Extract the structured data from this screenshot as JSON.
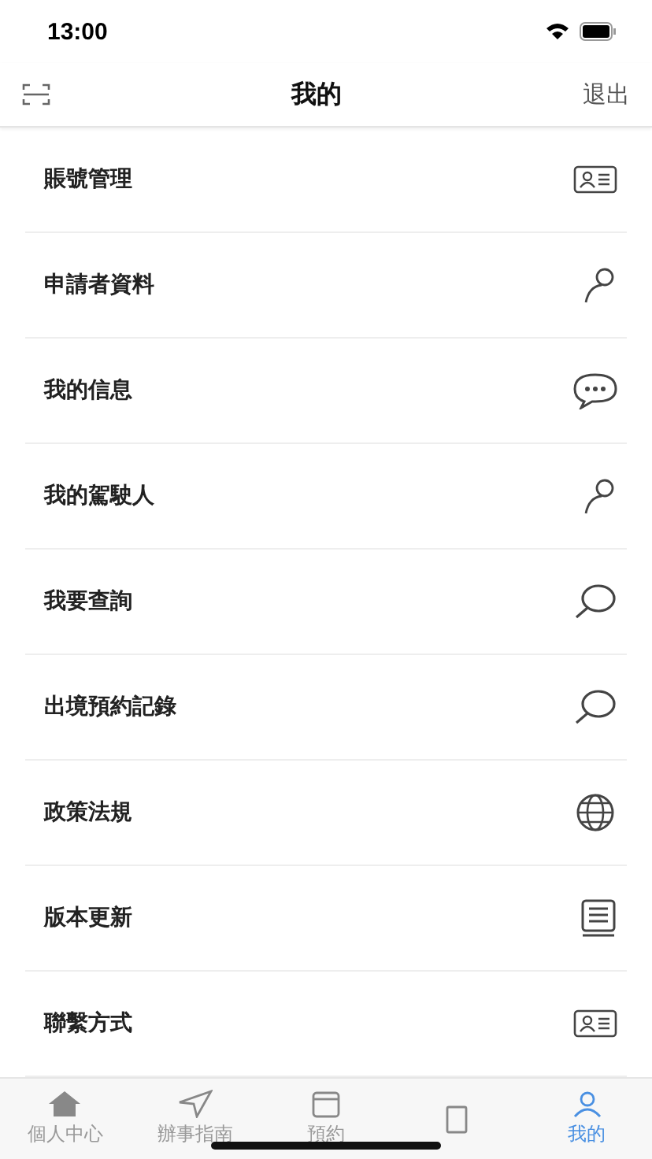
{
  "status_bar": {
    "time": "13:00"
  },
  "nav": {
    "title": "我的",
    "action": "退出"
  },
  "items": [
    {
      "label": "賬號管理",
      "kind": "card"
    },
    {
      "label": "申請者資料",
      "kind": "person"
    },
    {
      "label": "我的信息",
      "kind": "chat"
    },
    {
      "label": "我的駕駛人",
      "kind": "person"
    },
    {
      "label": "我要查詢",
      "kind": "search"
    },
    {
      "label": "出境預約記錄",
      "kind": "search"
    },
    {
      "label": "政策法規",
      "kind": "globe"
    },
    {
      "label": "版本更新",
      "kind": "book"
    },
    {
      "label": "聯繫方式",
      "kind": "card"
    }
  ],
  "tabs": [
    {
      "label": "個人中心",
      "kind": "home",
      "selected": false
    },
    {
      "label": "辦事指南",
      "kind": "send",
      "selected": false
    },
    {
      "label": "預約",
      "kind": "calendar",
      "selected": false
    },
    {
      "kind": "doc",
      "selected": false
    },
    {
      "label": "我的",
      "kind": "user",
      "selected": true
    }
  ]
}
